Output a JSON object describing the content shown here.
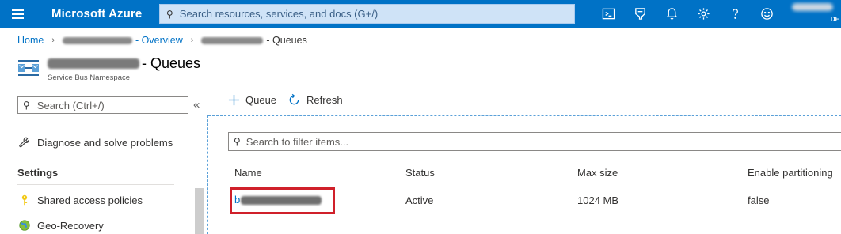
{
  "topbar": {
    "brand": "Microsoft Azure",
    "search_placeholder": "Search resources, services, and docs (G+/)",
    "icons": [
      "cloud-shell-icon",
      "directory-filter-icon",
      "notifications-icon",
      "settings-icon",
      "help-icon",
      "feedback-icon"
    ],
    "account_dir_label": "DE",
    "accent_color": "#0072c6"
  },
  "breadcrumb": {
    "home": "Home",
    "overview_suffix": "- Overview",
    "current_suffix": "- Queues"
  },
  "header": {
    "title_suffix": "- Queues",
    "subtitle": "Service Bus Namespace"
  },
  "nav": {
    "search_placeholder": "Search (Ctrl+/)",
    "collapse_glyph": "«",
    "diagnose": "Diagnose and solve problems",
    "settings_heading": "Settings",
    "items": [
      {
        "label": "Shared access policies",
        "icon": "key-icon"
      },
      {
        "label": "Geo-Recovery",
        "icon": "globe-icon"
      }
    ]
  },
  "commands": {
    "add_queue": "Queue",
    "refresh": "Refresh"
  },
  "filter": {
    "placeholder": "Search to filter items..."
  },
  "table": {
    "columns": [
      "Name",
      "Status",
      "Max size",
      "Enable partitioning"
    ],
    "rows": [
      {
        "name_prefix": "b",
        "status": "Active",
        "max_size": "1024 MB",
        "partitioning": "false"
      }
    ],
    "highlight_color": "#d0202a"
  }
}
